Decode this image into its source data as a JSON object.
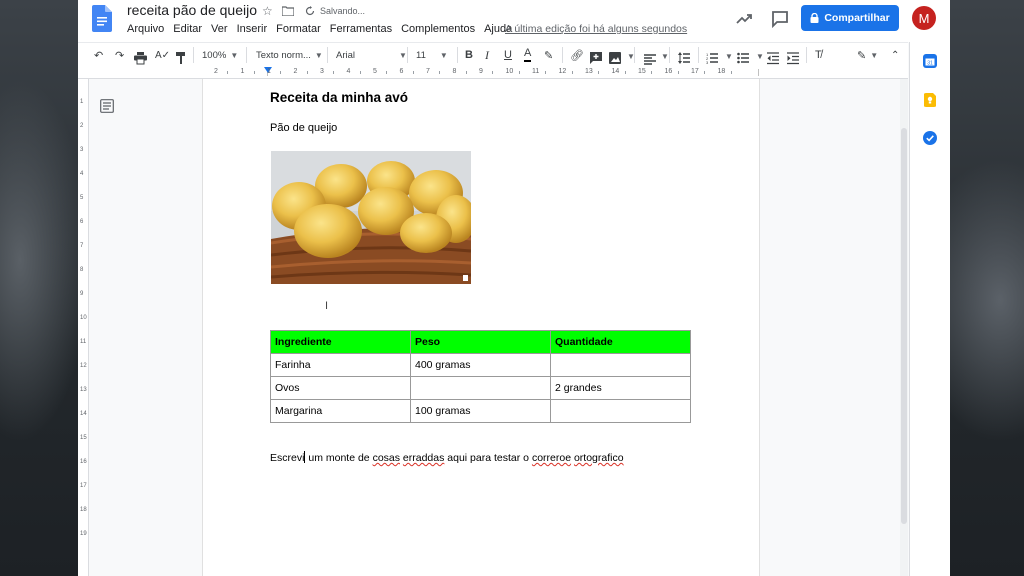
{
  "header": {
    "doc_title": "receita pão de queijo",
    "saving_status": "Salvando...",
    "menu": [
      "Arquivo",
      "Editar",
      "Ver",
      "Inserir",
      "Formatar",
      "Ferramentas",
      "Complementos",
      "Ajuda"
    ],
    "last_edit": "A última edição foi há alguns segundos",
    "share_label": "Compartilhar",
    "avatar_letter": "M"
  },
  "toolbar": {
    "zoom": "100%",
    "style": "Texto norm...",
    "font": "Arial",
    "font_size": "11"
  },
  "ruler": {
    "numbers": [
      "2",
      "1",
      "1",
      "2",
      "3",
      "4",
      "5",
      "6",
      "7",
      "8",
      "9",
      "10",
      "11",
      "12",
      "13",
      "14",
      "15",
      "16",
      "17",
      "18"
    ]
  },
  "vruler": {
    "numbers": [
      "1",
      "2",
      "3",
      "4",
      "5",
      "6",
      "7",
      "8",
      "9",
      "10",
      "11",
      "12",
      "13",
      "14",
      "15",
      "16",
      "17",
      "18",
      "19"
    ]
  },
  "document": {
    "heading": "Receita da minha avó",
    "subheading": "Pão de queijo",
    "table": {
      "headers": [
        "Ingrediente",
        "Peso",
        "Quantidade"
      ],
      "rows": [
        [
          "Farinha",
          "400 gramas",
          ""
        ],
        [
          "Ovos",
          "",
          "2 grandes"
        ],
        [
          "Margarina",
          "100 gramas",
          ""
        ]
      ]
    },
    "paragraph": {
      "p1": "Escrevi",
      "p2": " um monte de ",
      "w1": "cosas",
      "w2": "erraddas",
      "p3": " aqui para testar o ",
      "w3": "correroe",
      "w4": "ortografico"
    }
  },
  "colors": {
    "accent": "#1a73e8",
    "table_header": "#00ff00",
    "avatar": "#c5221f",
    "spellcheck": "#d93025"
  },
  "icons": [
    "undo-icon",
    "redo-icon",
    "print-icon",
    "spellcheck-icon",
    "paint-format-icon",
    "bold-icon",
    "italic-icon",
    "underline-icon",
    "text-color-icon",
    "highlight-icon",
    "link-icon",
    "comment-icon",
    "image-icon",
    "align-icon",
    "line-spacing-icon",
    "numbered-list-icon",
    "bulleted-list-icon",
    "indent-decrease-icon",
    "indent-increase-icon",
    "clear-format-icon",
    "pencil-icon",
    "collapse-icon",
    "star-icon",
    "folder-icon",
    "sync-icon",
    "trend-icon",
    "chat-icon",
    "lock-icon",
    "calendar-icon",
    "keep-icon",
    "tasks-icon",
    "outline-icon"
  ]
}
